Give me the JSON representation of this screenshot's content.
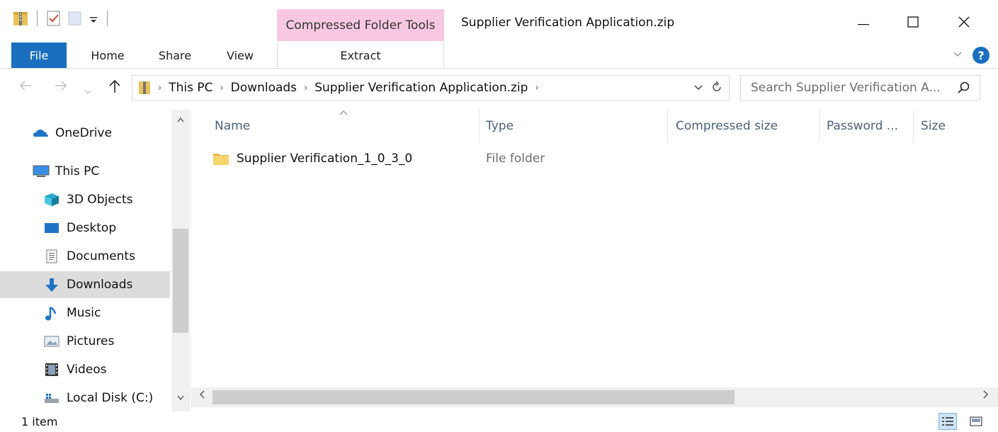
{
  "window": {
    "title": "Supplier Verification Application.zip",
    "context_tab_group": "Compressed Folder Tools"
  },
  "ribbon": {
    "tabs": [
      "File",
      "Home",
      "Share",
      "View",
      "Extract"
    ]
  },
  "address": {
    "crumbs": [
      "This PC",
      "Downloads",
      "Supplier Verification Application.zip"
    ],
    "search_placeholder": "Search Supplier Verification A..."
  },
  "navpane": {
    "items": [
      {
        "label": "OneDrive",
        "icon": "onedrive-icon"
      },
      {
        "label": "This PC",
        "icon": "this-pc-icon"
      },
      {
        "label": "3D Objects",
        "icon": "3d-objects-icon"
      },
      {
        "label": "Desktop",
        "icon": "desktop-icon"
      },
      {
        "label": "Documents",
        "icon": "documents-icon"
      },
      {
        "label": "Downloads",
        "icon": "downloads-icon",
        "selected": true
      },
      {
        "label": "Music",
        "icon": "music-icon"
      },
      {
        "label": "Pictures",
        "icon": "pictures-icon"
      },
      {
        "label": "Videos",
        "icon": "videos-icon"
      },
      {
        "label": "Local Disk (C:)",
        "icon": "local-disk-icon"
      }
    ]
  },
  "columns": [
    "Name",
    "Type",
    "Compressed size",
    "Password ...",
    "Size"
  ],
  "files": [
    {
      "name": "Supplier Verification_1_0_3_0",
      "type": "File folder"
    }
  ],
  "status": {
    "item_count": "1 item"
  },
  "colors": {
    "file_tab": "#1a6fbf",
    "context_tab": "#f8c8e1",
    "selected_nav": "#dcdcdc"
  }
}
